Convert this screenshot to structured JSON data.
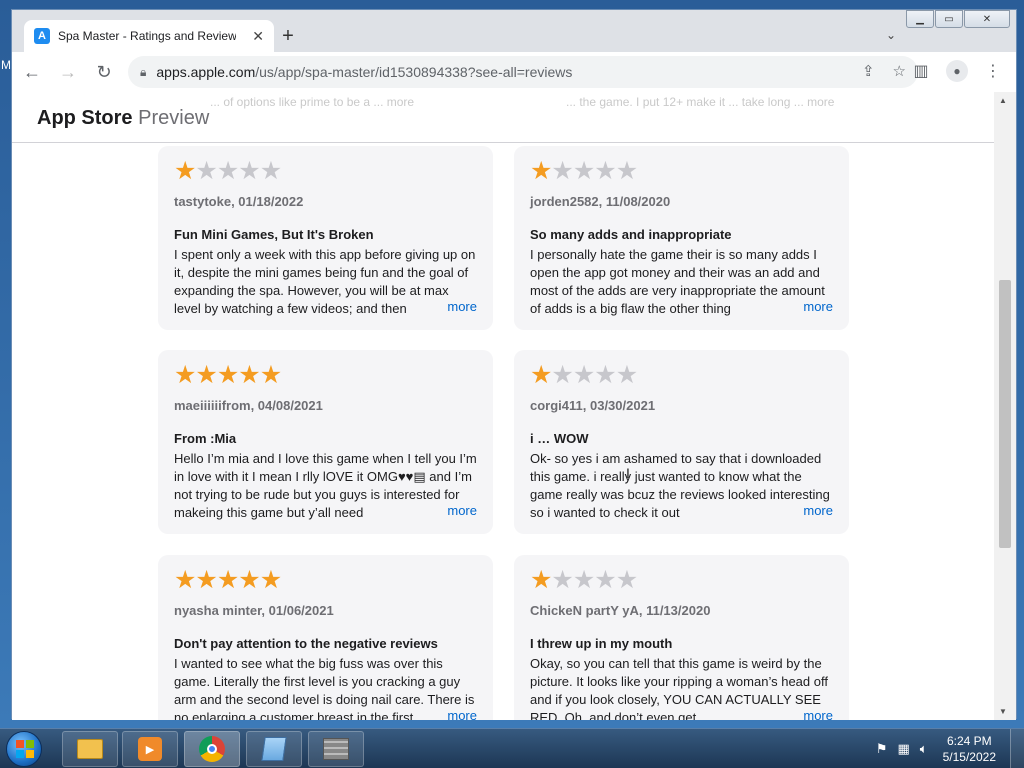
{
  "desktop": {
    "edge_text": "M"
  },
  "browser": {
    "tab_title": "Spa Master - Ratings and Reviews",
    "tab_icon": "A",
    "url_host": "apps.apple.com",
    "url_path": "/us/app/spa-master/id1530894338?see-all=reviews"
  },
  "header": {
    "brand_bold": "App Store",
    "brand_light": "Preview"
  },
  "faded": {
    "left": "... of options like prime to be a ... more",
    "right": "... the game. I put 12+ make it ... take long ... more"
  },
  "reviews": [
    {
      "rating": 1,
      "author_date": "tastytoke, 01/18/2022",
      "title": "Fun Mini Games, But It's Broken",
      "body": "I spent only a week with this app before giving up on it, despite the mini games being fun and the goal of expanding the spa. However, you will be at max level by watching a few videos; and then",
      "more": "more"
    },
    {
      "rating": 1,
      "author_date": "jorden2582, 11/08/2020",
      "title": "So many adds and inappropriate",
      "body": "I personally hate the game their is so many adds I open the app got money and their was an add and most of the adds are very inappropriate the amount of adds is a big flaw the other thing",
      "more": "more"
    },
    {
      "rating": 5,
      "author_date": "maeiiiiiifrom, 04/08/2021",
      "title": "From :Mia",
      "body": "Hello I’m mia and I love this game when I tell you I’m in love with it I mean I rlly lOVE it OMG♥♥▤ and I’m not trying to be rude but you guys is interested for makeing this game but y’all need",
      "more": "more"
    },
    {
      "rating": 1,
      "author_date": "corgi411, 03/30/2021",
      "title": "i … WOW",
      "body": "Ok- so yes i am ashamed to say that i downloaded this game. i really just wanted to know what the game really was bcuz the reviews looked interesting so i wanted to check it out",
      "more": "more"
    },
    {
      "rating": 5,
      "author_date": "nyasha minter, 01/06/2021",
      "title": "Don't pay attention to the negative reviews",
      "body": "I wanted to see what the big fuss was over this game. Literally the first level is you cracking a guy arm and the second level is doing nail care. There is no enlarging a customer breast in the first",
      "more": "more"
    },
    {
      "rating": 1,
      "author_date": "ChickeN partY yA, 11/13/2020",
      "title": "I threw up in my mouth",
      "body": "Okay, so you can tell that this game is weird by the picture. It looks like your ripping a woman’s head off and if you look closely, YOU CAN ACTUALLY SEE RED. Oh, and don’t even get",
      "more": "more"
    }
  ],
  "taskbar": {
    "time": "6:24 PM",
    "date": "5/15/2022"
  }
}
